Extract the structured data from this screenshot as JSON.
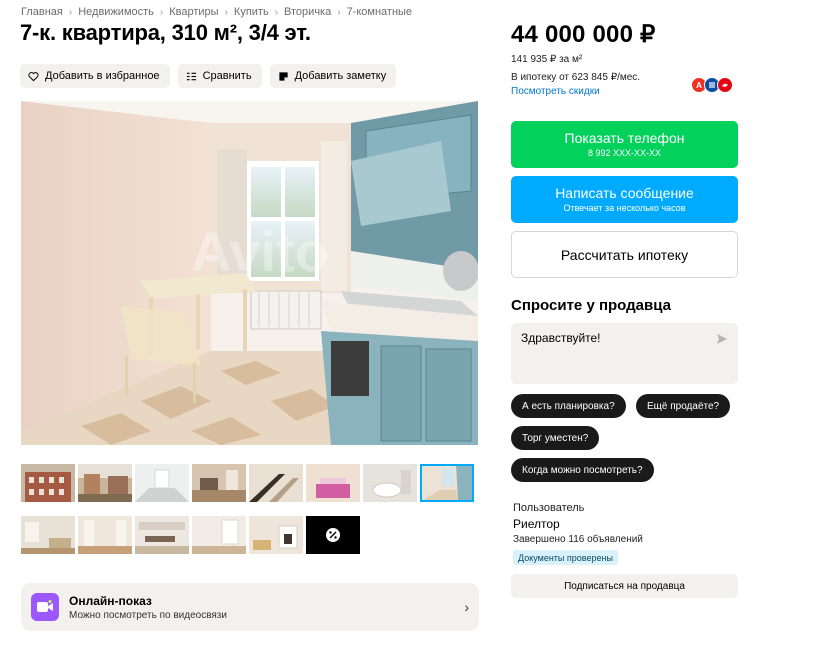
{
  "breadcrumbs": [
    "Главная",
    "Недвижимость",
    "Квартиры",
    "Купить",
    "Вторичка",
    "7-комнатные"
  ],
  "title": "7-к. квартира, 310 м², 3/4 эт.",
  "actions": {
    "favorite": "Добавить в избранное",
    "compare": "Сравнить",
    "note": "Добавить заметку"
  },
  "gallery": {
    "watermark": "Avito",
    "more_icon": "percent-icon",
    "thumbnails_row1": [
      {
        "name": "facade-thumb",
        "active": false
      },
      {
        "name": "courtyard-thumb",
        "active": false
      },
      {
        "name": "white-room-thumb",
        "active": false
      },
      {
        "name": "room-thumb",
        "active": false
      },
      {
        "name": "staircase-thumb",
        "active": false
      },
      {
        "name": "pink-bedroom-thumb",
        "active": false
      },
      {
        "name": "bathroom-thumb",
        "active": false
      },
      {
        "name": "kitchen-thumb",
        "active": true
      }
    ],
    "thumbnails_row2": [
      {
        "name": "living-room-thumb"
      },
      {
        "name": "hall-thumb"
      },
      {
        "name": "dining-room-thumb"
      },
      {
        "name": "bright-room-thumb"
      },
      {
        "name": "fireplace-thumb"
      }
    ]
  },
  "online_show": {
    "title": "Онлайн-показ",
    "subtitle": "Можно посмотреть по видеосвязи",
    "chevron": "›"
  },
  "price": {
    "total": "44 000 000 ₽",
    "per_m2": "141 935 ₽ за м²",
    "mortgage": "В ипотеку от 623 845 ₽/мес.",
    "discounts_link": "Посмотреть скидки",
    "bank_logos": [
      {
        "letter": "А",
        "color": "#ef3124"
      },
      {
        "letter": "",
        "color": "#0a4ea2"
      },
      {
        "letter": "",
        "color": "#e30613"
      }
    ]
  },
  "contact": {
    "phone_button": "Показать телефон",
    "phone_masked": "8 992 XXX-XX-XX",
    "message_button": "Написать сообщение",
    "message_sub": "Отвечает за несколько часов",
    "mortgage_button": "Рассчитать ипотеку"
  },
  "ask": {
    "title": "Спросите у продавца",
    "input_value": "Здравствуйте!",
    "quick_replies": [
      "А есть планировка?",
      "Ещё продаёте?",
      "Торг уместен?",
      "Когда можно посмотреть?"
    ]
  },
  "seller": {
    "type": "Пользователь",
    "name": "Риелтор",
    "completed": "Завершено 116 объявлений",
    "badge": "Документы проверены",
    "subscribe": "Подписаться на продавца"
  },
  "colors": {
    "green": "#02d15c",
    "blue": "#00aaff",
    "link": "#0077cc",
    "chip_bg": "#f2f1f0"
  }
}
